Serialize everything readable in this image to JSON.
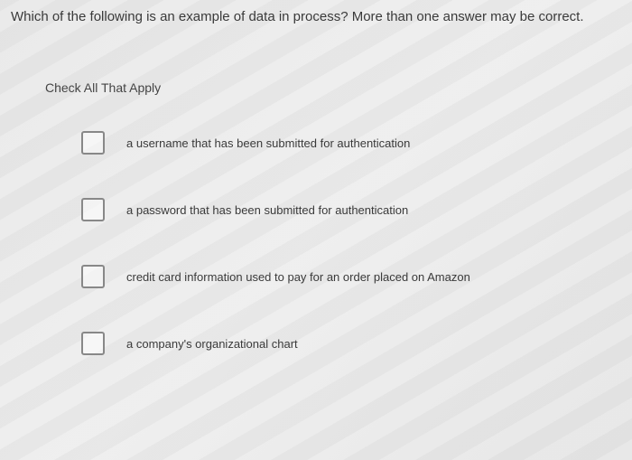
{
  "question": "Which of the following is an example of data in process? More than one answer may be correct.",
  "instruction": "Check All That Apply",
  "options": [
    {
      "label": "a username that has been submitted for authentication"
    },
    {
      "label": "a password that has been submitted for authentication"
    },
    {
      "label": "credit card information used to pay for an order placed on Amazon"
    },
    {
      "label": "a company's organizational chart"
    }
  ]
}
